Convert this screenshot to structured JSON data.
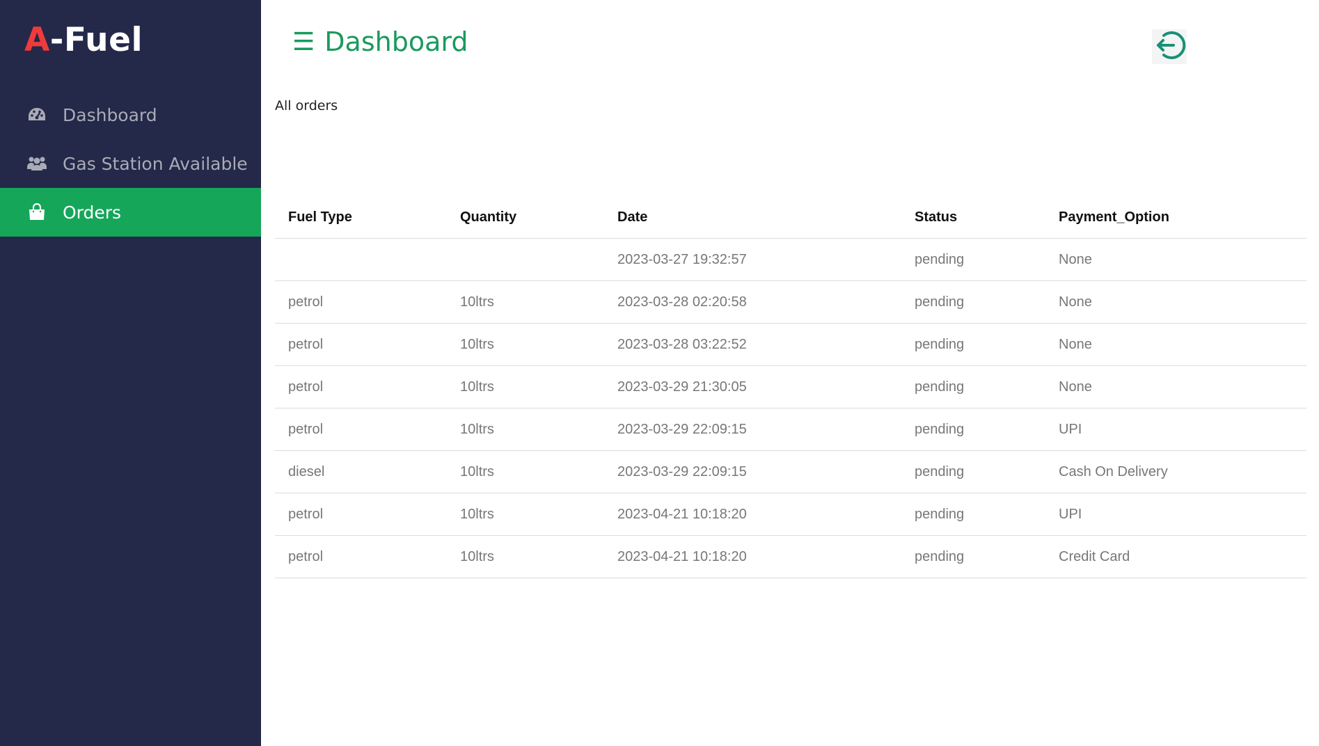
{
  "brand": {
    "prefix": "A",
    "rest": "-Fuel"
  },
  "sidebar": {
    "items": [
      {
        "label": "Dashboard",
        "icon": "dashboard-gauge-icon",
        "active": false
      },
      {
        "label": "Gas Station Available",
        "icon": "users-icon",
        "active": false
      },
      {
        "label": "Orders",
        "icon": "shopping-bag-icon",
        "active": true
      }
    ]
  },
  "header": {
    "menu_glyph": "☰",
    "title": "Dashboard",
    "logout_icon": "logout-icon"
  },
  "section": {
    "label": "All orders"
  },
  "table": {
    "columns": [
      "Fuel Type",
      "Quantity",
      "Date",
      "Status",
      "Payment_Option"
    ],
    "rows": [
      [
        "",
        "",
        "2023-03-27 19:32:57",
        "pending",
        "None"
      ],
      [
        "petrol",
        "10ltrs",
        "2023-03-28 02:20:58",
        "pending",
        "None"
      ],
      [
        "petrol",
        "10ltrs",
        "2023-03-28 03:22:52",
        "pending",
        "None"
      ],
      [
        "petrol",
        "10ltrs",
        "2023-03-29 21:30:05",
        "pending",
        "None"
      ],
      [
        "petrol",
        "10ltrs",
        "2023-03-29 22:09:15",
        "pending",
        "UPI"
      ],
      [
        "diesel",
        "10ltrs",
        "2023-03-29 22:09:15",
        "pending",
        "Cash On Delivery"
      ],
      [
        "petrol",
        "10ltrs",
        "2023-04-21 10:18:20",
        "pending",
        "UPI"
      ],
      [
        "petrol",
        "10ltrs",
        "2023-04-21 10:18:20",
        "pending",
        "Credit Card"
      ]
    ]
  },
  "colors": {
    "sidebar_bg": "#242849",
    "active_bg": "#15a65a",
    "accent": "#1a9a5e",
    "brand_red": "#ef3b3b"
  }
}
